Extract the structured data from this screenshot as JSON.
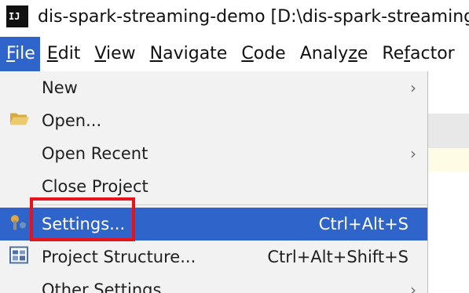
{
  "window": {
    "app_icon_text": "IJ",
    "title": "dis-spark-streaming-demo [D:\\dis-spark-streaming-demo]"
  },
  "menubar": {
    "items": [
      {
        "label": "File",
        "mnemonic": "F",
        "rest": "ile"
      },
      {
        "label": "Edit",
        "mnemonic": "E",
        "rest": "dit"
      },
      {
        "label": "View",
        "mnemonic": "V",
        "rest": "iew"
      },
      {
        "label": "Navigate",
        "mnemonic": "N",
        "rest": "avigate"
      },
      {
        "label": "Code",
        "mnemonic": "C",
        "rest": "ode"
      },
      {
        "label": "Analyze",
        "pre": "Analy",
        "mnemonic": "z",
        "rest": "e"
      },
      {
        "label": "Refactor",
        "pre": "Re",
        "mnemonic": "f",
        "rest": "actor"
      }
    ]
  },
  "file_menu": {
    "items": [
      {
        "label": "New",
        "shortcut": "",
        "submenu_arrow": "›",
        "icon": ""
      },
      {
        "label": "Open...",
        "shortcut": "",
        "submenu_arrow": "",
        "icon": "folder-open-icon"
      },
      {
        "label": "Open Recent",
        "shortcut": "",
        "submenu_arrow": "›",
        "icon": ""
      },
      {
        "label": "Close Project",
        "shortcut": "",
        "submenu_arrow": "",
        "icon": ""
      },
      {
        "label": "Settings...",
        "shortcut": "Ctrl+Alt+S",
        "submenu_arrow": "",
        "icon": "settings-wrench-icon",
        "selected": true
      },
      {
        "label": "Project Structure...",
        "shortcut": "Ctrl+Alt+Shift+S",
        "submenu_arrow": "",
        "icon": "project-structure-icon"
      },
      {
        "label": "Other Settings",
        "shortcut": "",
        "submenu_arrow": "›",
        "icon": ""
      }
    ]
  },
  "colors": {
    "selection": "#2f65ca",
    "menu_background": "#f2f2f2",
    "annotation_red": "#e6131a"
  },
  "annotation": {
    "target": "Settings..."
  }
}
